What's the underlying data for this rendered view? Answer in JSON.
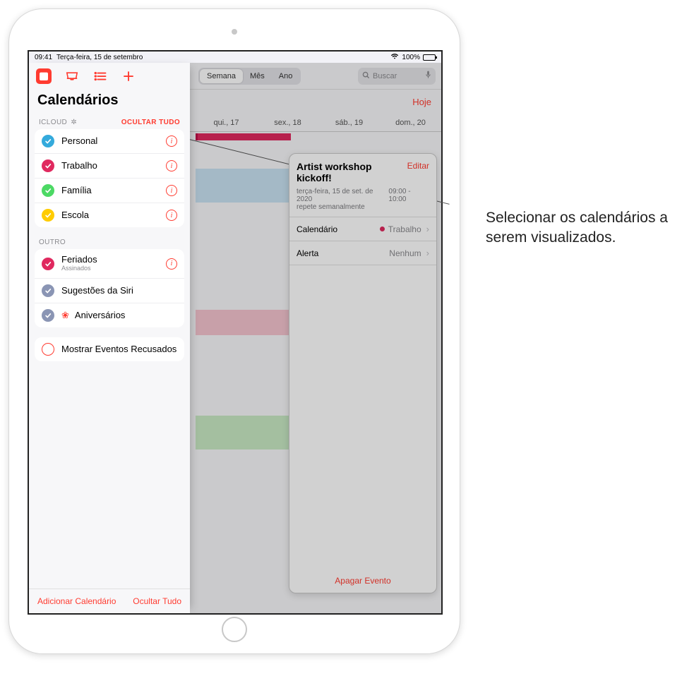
{
  "status": {
    "time": "09:41",
    "date": "Terça-feira, 15 de setembro",
    "battery": "100%"
  },
  "viewSeg": {
    "semana": "Semana",
    "mes": "Mês",
    "ano": "Ano"
  },
  "search": {
    "placeholder": "Buscar"
  },
  "todayButton": "Hoje",
  "days": {
    "qui": "qui., 17",
    "sex": "sex., 18",
    "sab": "sáb., 19",
    "dom": "dom., 20"
  },
  "event": {
    "title": "Artist workshop kickoff!",
    "edit": "Editar",
    "dateLine": "terça-feira, 15 de set. de 2020",
    "timeRange": "09:00 - 10:00",
    "repeat": "repete semanalmente",
    "calendarLabel": "Calendário",
    "calendarValue": "Trabalho",
    "calendarColor": "#e0295f",
    "alertLabel": "Alerta",
    "alertValue": "Nenhum",
    "delete": "Apagar Evento"
  },
  "panel": {
    "title": "Calendários",
    "icloudHeader": "ICLOUD",
    "hideAll": "OCULTAR TUDO",
    "icloudItems": [
      {
        "label": "Personal",
        "color": "#34aadc"
      },
      {
        "label": "Trabalho",
        "color": "#e0295f"
      },
      {
        "label": "Família",
        "color": "#4cd964"
      },
      {
        "label": "Escola",
        "color": "#ffcc00"
      }
    ],
    "otherHeader": "OUTRO",
    "otherItems": [
      {
        "label": "Feriados",
        "sub": "Assinados",
        "color": "#e0295f",
        "info": true
      },
      {
        "label": "Sugestões da Siri",
        "color": "#8a95b4",
        "info": false
      },
      {
        "label": "Aniversários",
        "gift": true
      }
    ],
    "declined": "Mostrar Eventos Recusados",
    "addCalendar": "Adicionar Calendário",
    "footerHideAll": "Ocultar Tudo"
  },
  "callout": {
    "text": "Selecionar os calendários a serem visualizados."
  }
}
